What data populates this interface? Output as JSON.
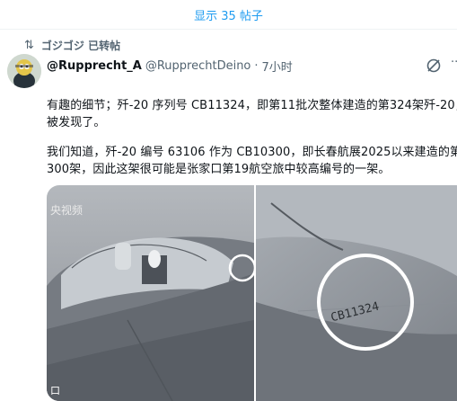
{
  "show_posts": "显示 35 帖子",
  "repost": {
    "label": "ゴジゴジ 已转帖"
  },
  "post": {
    "display_name": "@Rupprecht_A",
    "handle": "@RupprechtDeino",
    "separator": "·",
    "time": "7小时",
    "text_lines": [
      "有趣的细节；歼-20 序列号 CB11324，即第11批次整体建造的第324架歼-20，",
      "被发现了。",
      "我们知道，歼-20 编号 63106 作为 CB10300，即长春航展2025以来建造的第",
      "300架，因此这架很可能是张家口第19航空旅中较高编号的一架。"
    ]
  },
  "media": {
    "left_watermark": "央视频",
    "left_corner": "口",
    "serial": "CB11324"
  },
  "icons": {
    "repost": "repost-icon",
    "grok": "grok-icon",
    "more": "more-icon"
  },
  "colors": {
    "link": "#1d9bf0",
    "secondary": "#536471",
    "marker": "#ffffff"
  }
}
